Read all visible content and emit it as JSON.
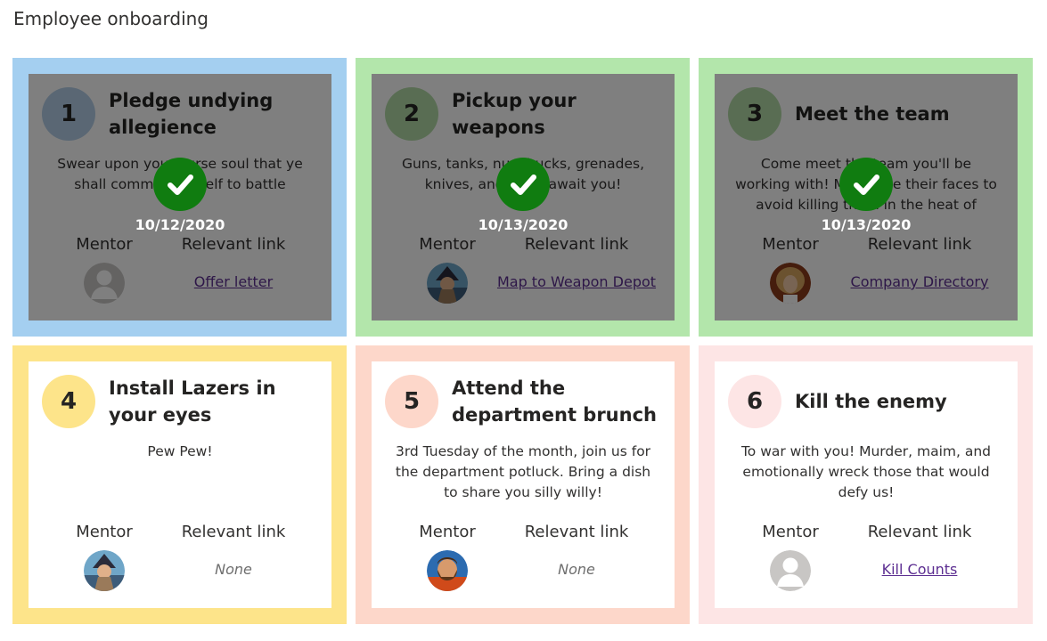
{
  "page": {
    "title": "Employee onboarding"
  },
  "colors": {
    "completed_check": "#107c10",
    "link": "#5c2e91"
  },
  "labels": {
    "mentor": "Mentor",
    "relevant_link": "Relevant link"
  },
  "cards": [
    {
      "number": "1",
      "title": "Pledge undying allegience",
      "description": "Swear upon your curse soul that ye shall commit yourself to battle",
      "completed": true,
      "completed_date": "10/12/2020",
      "mentor_avatar": "default-avatar",
      "link": "Offer letter",
      "link_is_none": false,
      "border_color": "#a4cff0",
      "number_bg": "#b4cfe8"
    },
    {
      "number": "2",
      "title": "Pickup your weapons",
      "description": "Guns, tanks, nunchucks, grenades, knives, and more await you!",
      "completed": true,
      "completed_date": "10/13/2020",
      "mentor_avatar": "photo-avatar-wizard",
      "link": "Map to Weapon Depot",
      "link_is_none": false,
      "border_color": "#b3e6ab",
      "number_bg": "#b3dba6"
    },
    {
      "number": "3",
      "title": "Meet the team",
      "description": "Come meet the team you'll be working with! Memorize their faces to avoid killing them in the heat of battle!",
      "completed": true,
      "completed_date": "10/13/2020",
      "mentor_avatar": "photo-avatar-rocker",
      "link": "Company Directory",
      "link_is_none": false,
      "border_color": "#b3e6ab",
      "number_bg": "#b3dba6"
    },
    {
      "number": "4",
      "title": "Install Lazers in your eyes",
      "description": "Pew Pew!",
      "completed": false,
      "completed_date": "",
      "mentor_avatar": "photo-avatar-wizard",
      "link": "None",
      "link_is_none": true,
      "border_color": "#fde48a",
      "number_bg": "#fde48a"
    },
    {
      "number": "5",
      "title": "Attend the department brunch",
      "description": "3rd Tuesday of the month, join us for the department potluck. Bring a dish to share you silly willy!",
      "completed": false,
      "completed_date": "",
      "mentor_avatar": "photo-avatar-bearded",
      "link": "None",
      "link_is_none": true,
      "border_color": "#fdd7ca",
      "number_bg": "#fdd7ca"
    },
    {
      "number": "6",
      "title": "Kill the enemy",
      "description": "To war with you! Murder, maim, and emotionally wreck those that would defy us!",
      "completed": false,
      "completed_date": "",
      "mentor_avatar": "default-avatar",
      "link": "Kill Counts",
      "link_is_none": false,
      "border_color": "#fde5e5",
      "number_bg": "#fde5e5"
    }
  ]
}
